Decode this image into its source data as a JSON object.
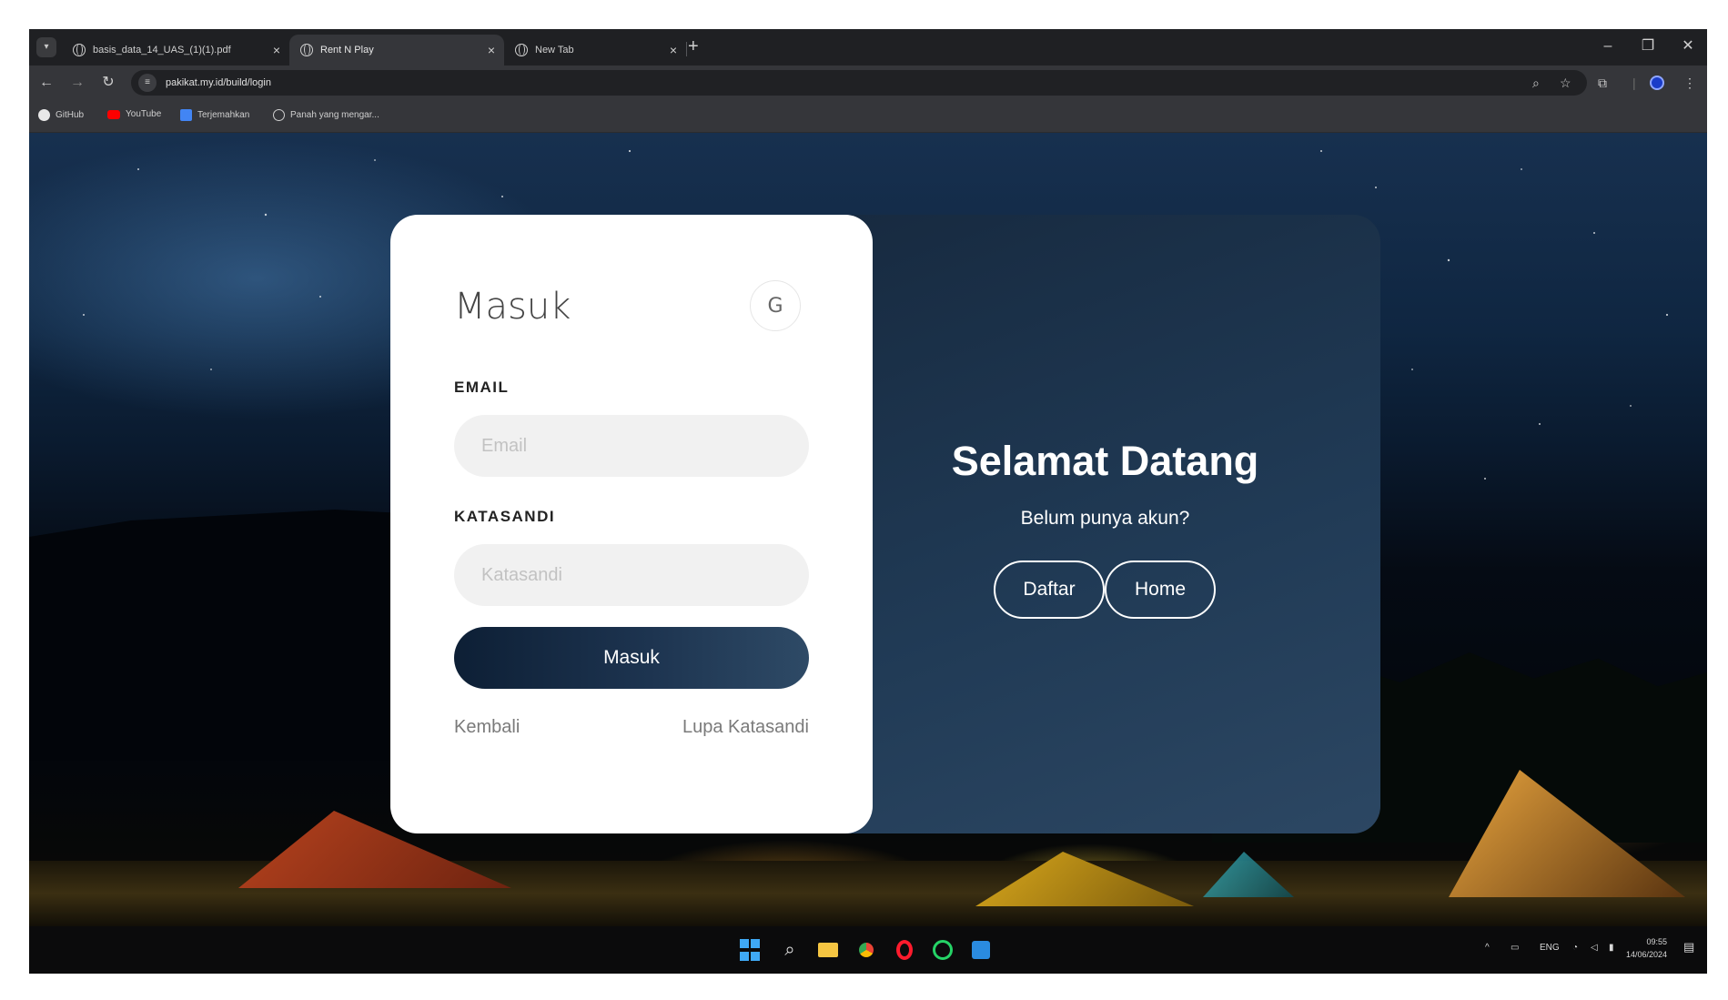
{
  "browser": {
    "tabs": [
      {
        "label": "basis_data_14_UAS_(1)(1).pdf",
        "active": false
      },
      {
        "label": "Rent N Play",
        "active": true
      },
      {
        "label": "New Tab",
        "active": false
      }
    ],
    "new_tab_symbol": "+",
    "url": "pakikat.my.id/build/login",
    "bookmarks": [
      {
        "label": "GitHub",
        "icon": "github-icon"
      },
      {
        "label": "YouTube",
        "icon": "youtube-icon"
      },
      {
        "label": "Terjemahkan",
        "icon": "translate-icon"
      },
      {
        "label": "Panah yang mengar...",
        "icon": "globe-icon"
      }
    ]
  },
  "login": {
    "title": "Masuk",
    "google_label": "G",
    "email_label": "EMAIL",
    "email_placeholder": "Email",
    "password_label": "KATASANDI",
    "password_placeholder": "Katasandi",
    "submit_label": "Masuk",
    "back_link": "Kembali",
    "forgot_link": "Lupa Katasandi"
  },
  "welcome": {
    "title": "Selamat Datang",
    "subtitle": "Belum punya akun?",
    "register_label": "Daftar",
    "home_label": "Home"
  },
  "taskbar": {
    "language": "ENG",
    "time": "09:55",
    "date": "14/06/2024"
  },
  "colors": {
    "card_dark": "#1d3450",
    "button_dark": "#0d1f35",
    "input_bg": "#f1f1f1",
    "browser_chrome": "#35363a"
  }
}
